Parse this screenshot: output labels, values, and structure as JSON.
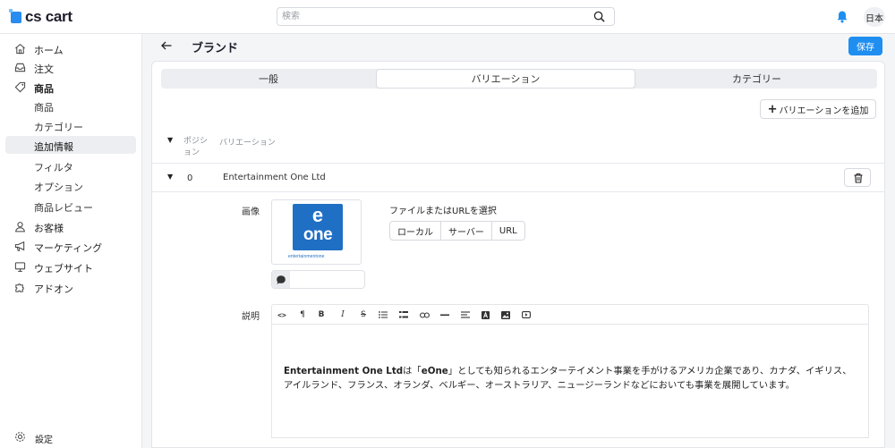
{
  "app": {
    "logo_text": "cs cart",
    "brand_color": "#1f8ef1"
  },
  "search": {
    "placeholder": "検索"
  },
  "topbar": {
    "lang_label": "日本"
  },
  "sidebar": {
    "items": [
      {
        "label": "ホーム",
        "icon": "home-icon"
      },
      {
        "label": "注文",
        "icon": "inbox-icon"
      },
      {
        "label": "商品",
        "icon": "tag-icon"
      }
    ],
    "sub_items": [
      {
        "label": "商品"
      },
      {
        "label": "カテゴリー"
      },
      {
        "label": "追加情報"
      },
      {
        "label": "フィルタ"
      },
      {
        "label": "オプション"
      },
      {
        "label": "商品レビュー"
      }
    ],
    "items2": [
      {
        "label": "お客様",
        "icon": "user-icon"
      },
      {
        "label": "マーケティング",
        "icon": "megaphone-icon"
      },
      {
        "label": "ウェブサイト",
        "icon": "monitor-icon"
      },
      {
        "label": "アドオン",
        "icon": "puzzle-icon"
      }
    ],
    "settings_label": "設定"
  },
  "header": {
    "title": "ブランド",
    "save_label": "保存"
  },
  "tabs": [
    {
      "label": "一般"
    },
    {
      "label": "バリエーション"
    },
    {
      "label": "カテゴリー"
    }
  ],
  "variations": {
    "add_label": "バリエーションを追加",
    "col_position": "ポジション",
    "col_variation": "バリエーション",
    "rows": [
      {
        "position": "0",
        "name": "Entertainment One Ltd"
      }
    ]
  },
  "detail": {
    "image_label": "画像",
    "logo_e": "e",
    "logo_one": "one",
    "logo_tagline": "entertainmentone",
    "file_label": "ファイルまたはURLを選択",
    "sources": [
      "ローカル",
      "サーバー",
      "URL"
    ],
    "desc_label": "説明",
    "description_bold": "Entertainment One Ltd",
    "description_mid": "は「",
    "description_bold2": "eOne",
    "description_rest": "」としても知られるエンターテイメント事業を手がけるアメリカ企業であり、カナダ、イギリス、アイルランド、フランス、オランダ、ベルギー、オーストラリア、ニュージーランドなどにおいても事業を展開しています。"
  },
  "toolbar_icons": [
    "code-icon",
    "paragraph-icon",
    "bold-icon",
    "italic-icon",
    "strikethrough-icon",
    "bullet-list-icon",
    "numbered-list-icon",
    "link-icon",
    "horizontal-rule-icon",
    "align-icon",
    "text-color-icon",
    "image-icon",
    "video-icon"
  ]
}
